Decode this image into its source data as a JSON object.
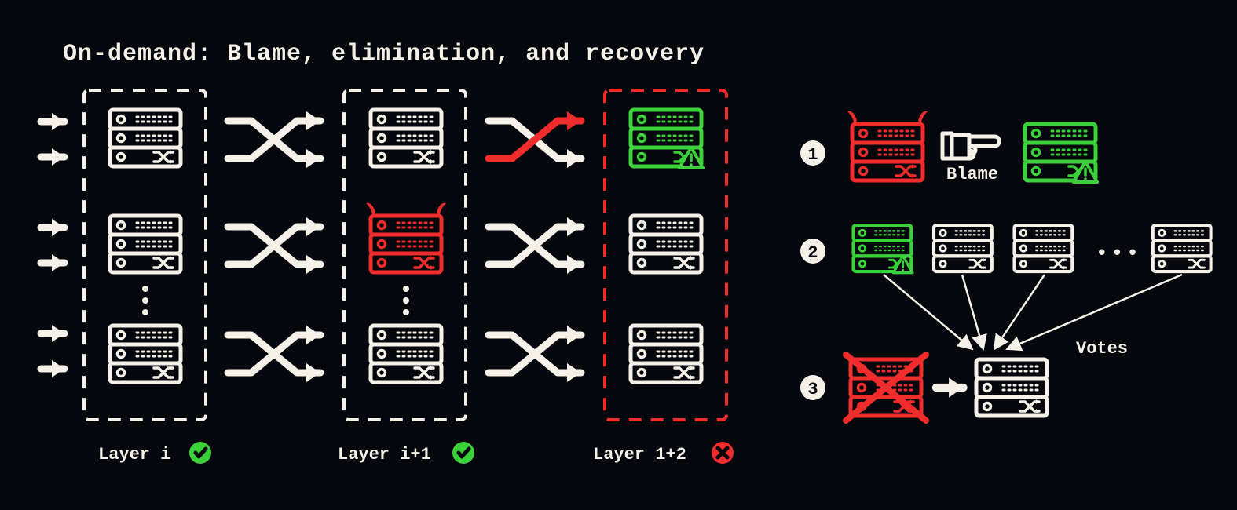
{
  "title": "On-demand: Blame, elimination, and recovery",
  "layers": [
    {
      "name": "Layer i",
      "status": "ok"
    },
    {
      "name": "Layer i+1",
      "status": "ok"
    },
    {
      "name": "Layer 1+2",
      "status": "fail"
    }
  ],
  "steps": {
    "s1": "Blame",
    "s2": "Votes"
  },
  "badges": [
    "1",
    "2",
    "3"
  ],
  "colors": {
    "cream": "#F5F1E8",
    "red": "#F02C2C",
    "green": "#3BD13B",
    "bg": "#06080E"
  },
  "ellipsis": "•••"
}
